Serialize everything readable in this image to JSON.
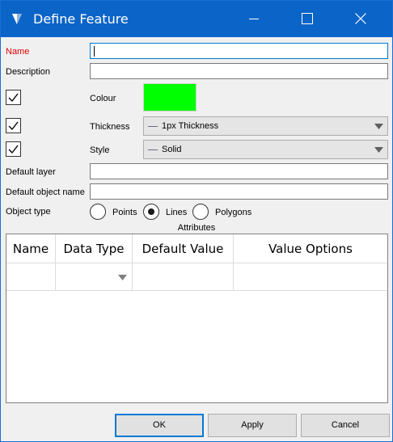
{
  "window": {
    "title": "Define Feature"
  },
  "fields": {
    "name_label": "Name",
    "name_value": "",
    "description_label": "Description",
    "description_value": "",
    "colour_label": "Colour",
    "colour_value": "#00ff00",
    "colour_checked": true,
    "thickness_label": "Thickness",
    "thickness_value": "1px Thickness",
    "thickness_checked": true,
    "style_label": "Style",
    "style_value": "Solid",
    "style_checked": true,
    "default_layer_label": "Default layer",
    "default_layer_value": "",
    "default_object_name_label": "Default object name",
    "default_object_name_value": ""
  },
  "object_type": {
    "label": "Object type",
    "options": [
      "Points",
      "Lines",
      "Polygons"
    ],
    "selected": "Lines"
  },
  "attributes": {
    "caption": "Attributes",
    "columns": [
      "Name",
      "Data Type",
      "Default Value",
      "Value Options"
    ],
    "rows": [
      [
        "",
        "",
        "",
        ""
      ]
    ]
  },
  "buttons": {
    "ok": "OK",
    "apply": "Apply",
    "cancel": "Cancel"
  },
  "icons": {
    "app": "app-logo-icon",
    "minimize": "minimize-icon",
    "maximize": "maximize-icon",
    "close": "close-icon",
    "checkbox": "checkmark-icon",
    "dropdown": "chevron-down-icon"
  }
}
